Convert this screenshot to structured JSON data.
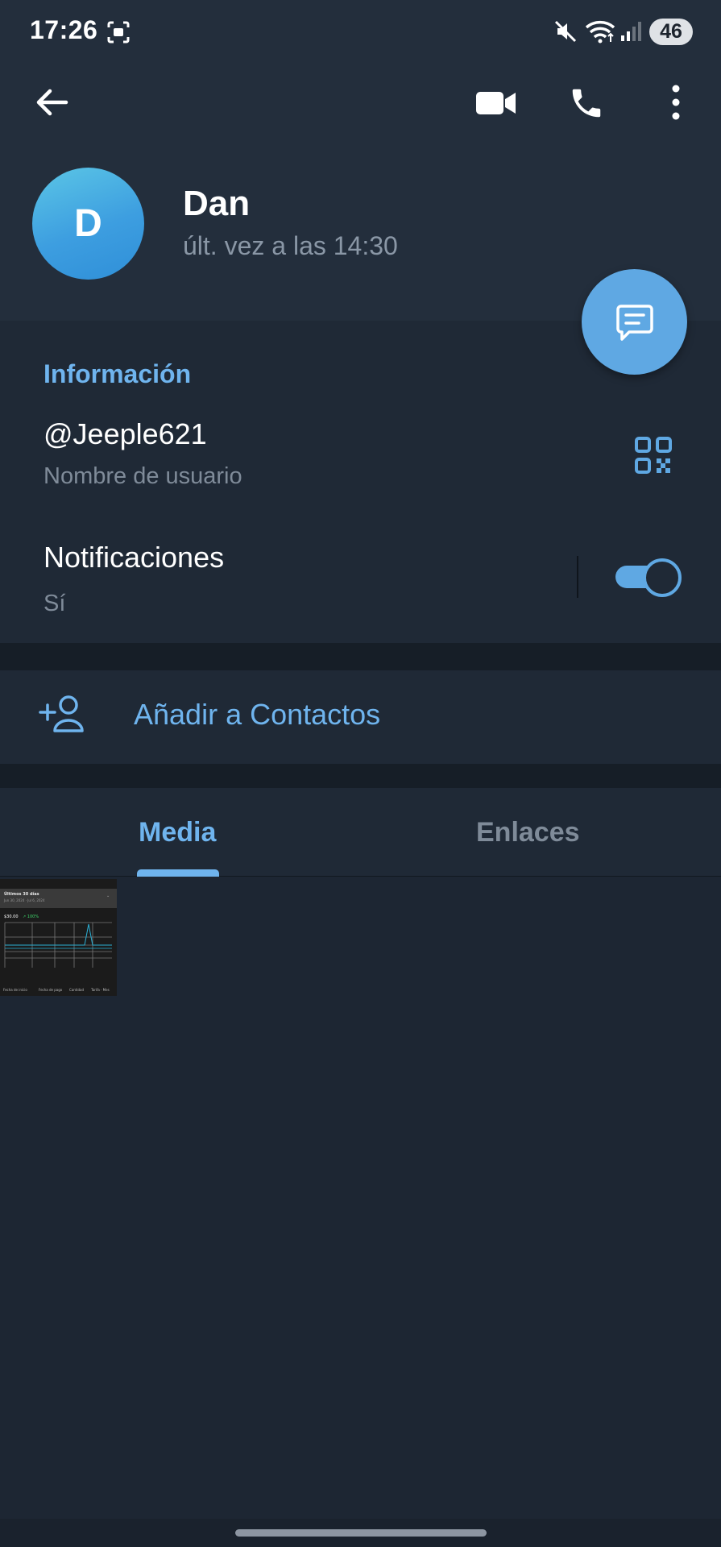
{
  "status_bar": {
    "time": "17:26",
    "battery": "46",
    "icons": [
      "screenshot-icon",
      "mute-icon",
      "wifi-icon",
      "signal-icon"
    ]
  },
  "header": {
    "icons": [
      "back-arrow-icon",
      "video-camera-icon",
      "phone-icon",
      "more-vertical-icon"
    ]
  },
  "profile": {
    "avatar_initial": "D",
    "name": "Dan",
    "status": "últ. vez a las 14:30",
    "avatar_colors": [
      "#5bc6e6",
      "#2f8fd8"
    ]
  },
  "info": {
    "title": "Información",
    "username": "@Jeeple621",
    "username_caption": "Nombre de usuario",
    "notifications_label": "Notificaciones",
    "notifications_value": "Sí",
    "notifications_on": true
  },
  "actions": {
    "add_contact": "Añadir a Contactos"
  },
  "tabs": [
    {
      "label": "Media",
      "active": true
    },
    {
      "label": "Enlaces",
      "active": false
    }
  ],
  "media_thumbnail": {
    "title": "Últimos 30 días",
    "subtitle": "Jun 30, 2024 · Jul 6, 2024",
    "value": "$30.00",
    "change": "↗ 100%",
    "columns": [
      "Fecha de inicio",
      "Fecha de pago",
      "Cantidad",
      "Tarifa · Mes"
    ]
  },
  "colors": {
    "accent": "#6fb4ee",
    "background": "#1d2633",
    "header": "#232e3c",
    "fab": "#5fa8e3"
  }
}
